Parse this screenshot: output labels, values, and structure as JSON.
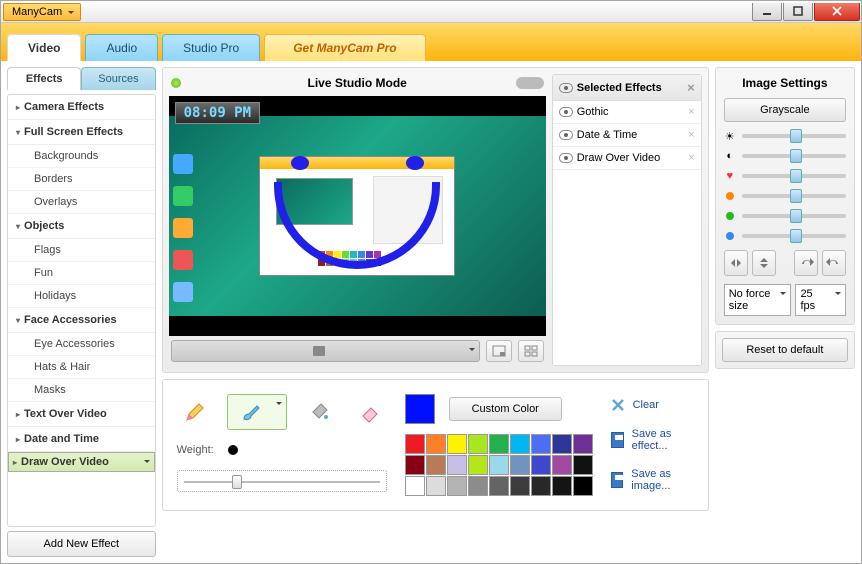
{
  "title": "ManyCam",
  "tabs": {
    "video": "Video",
    "audio": "Audio",
    "studio": "Studio Pro",
    "pro": "Get ManyCam Pro"
  },
  "subtabs": {
    "effects": "Effects",
    "sources": "Sources"
  },
  "fx": {
    "cat_camera": "Camera Effects",
    "cat_fullscreen": "Full Screen Effects",
    "backgrounds": "Backgrounds",
    "borders": "Borders",
    "overlays": "Overlays",
    "cat_objects": "Objects",
    "flags": "Flags",
    "fun": "Fun",
    "holidays": "Holidays",
    "cat_face": "Face Accessories",
    "eye": "Eye Accessories",
    "hats": "Hats & Hair",
    "masks": "Masks",
    "text": "Text Over Video",
    "date": "Date and Time",
    "draw": "Draw Over Video"
  },
  "addnew": "Add New Effect",
  "preview": {
    "title": "Live Studio Mode",
    "timestamp": "08:09 PM"
  },
  "selfx": {
    "header": "Selected Effects",
    "items": [
      "Gothic",
      "Date & Time",
      "Draw Over Video"
    ]
  },
  "tools": {
    "weight": "Weight:"
  },
  "colors": {
    "custom": "Custom Color",
    "current": "#0010ff",
    "palette": [
      "#ed1c24",
      "#ff7f27",
      "#fff200",
      "#a8e61d",
      "#22b14c",
      "#00b7ef",
      "#4d6df3",
      "#2f3699",
      "#6f3198",
      "#880015",
      "#b97a57",
      "#c8bfe7",
      "#b5e61d",
      "#99d9ea",
      "#7092be",
      "#3f48cc",
      "#a349a4",
      "#111111",
      "#ffffff",
      "#dcdcdc",
      "#b4b4b4",
      "#8c8c8c",
      "#646464",
      "#3c3c3c",
      "#282828",
      "#141414",
      "#000000"
    ]
  },
  "actions": {
    "clear": "Clear",
    "save_effect": "Save as effect...",
    "save_image": "Save as image..."
  },
  "image_settings": {
    "title": "Image Settings",
    "grayscale": "Grayscale",
    "size": "No force size",
    "fps": "25 fps",
    "reset": "Reset to default"
  }
}
